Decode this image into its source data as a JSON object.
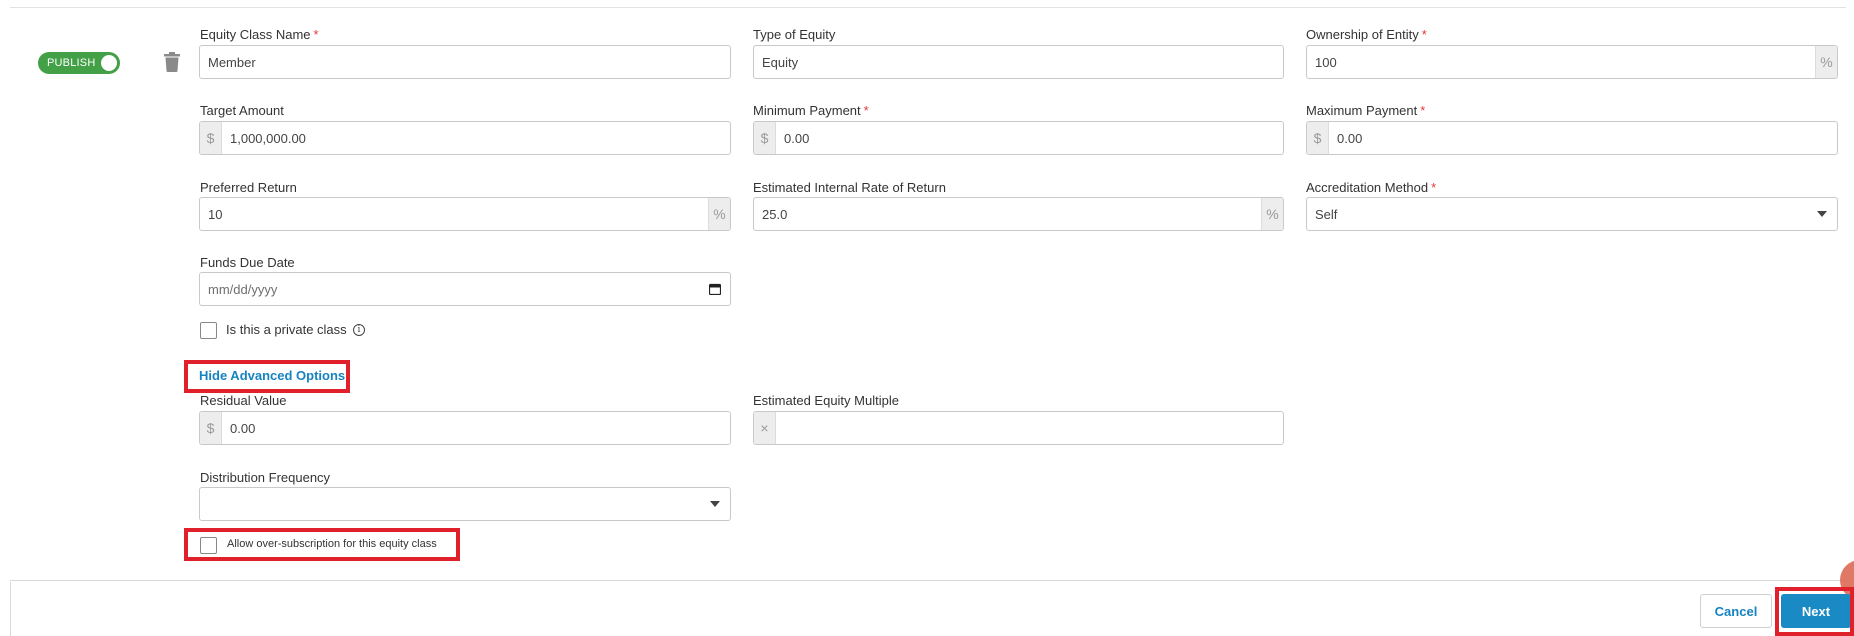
{
  "toggle": {
    "label": "PUBLISH",
    "on": true
  },
  "fields": {
    "equity_class_name": {
      "label": "Equity Class Name",
      "required": "*",
      "value": "Member"
    },
    "type_of_equity": {
      "label": "Type of Equity",
      "value": "Equity"
    },
    "ownership_of_entity": {
      "label": "Ownership of Entity",
      "required": "*",
      "value": "100",
      "suffix": "%"
    },
    "target_amount": {
      "label": "Target Amount",
      "prefix": "$",
      "value": "1,000,000.00"
    },
    "minimum_payment": {
      "label": "Minimum Payment",
      "required": "*",
      "prefix": "$",
      "value": "0.00"
    },
    "maximum_payment": {
      "label": "Maximum Payment",
      "required": "*",
      "prefix": "$",
      "value": "0.00"
    },
    "preferred_return": {
      "label": "Preferred Return",
      "value": "10",
      "suffix": "%"
    },
    "estimated_irr": {
      "label": "Estimated Internal Rate of Return",
      "value": "25.0",
      "suffix": "%"
    },
    "accreditation_method": {
      "label": "Accreditation Method",
      "required": "*",
      "value": "Self"
    },
    "funds_due_date": {
      "label": "Funds Due Date",
      "placeholder": "mm/dd/yyyy"
    },
    "private_class": {
      "label": "Is this a private class",
      "info": "i"
    },
    "residual_value": {
      "label": "Residual Value",
      "prefix": "$",
      "value": "0.00"
    },
    "estimated_equity_multiple": {
      "label": "Estimated Equity Multiple",
      "prefix": "×",
      "value": ""
    },
    "distribution_frequency": {
      "label": "Distribution Frequency",
      "value": ""
    },
    "oversubscription": {
      "label": "Allow over-subscription for this equity class"
    }
  },
  "advanced_toggle_label": "Hide Advanced Options",
  "buttons": {
    "cancel": "Cancel",
    "next": "Next"
  },
  "colors": {
    "accent": "#1583c2",
    "toggle_on": "#43a047",
    "highlight": "#e0202a",
    "required": "#e53935"
  }
}
